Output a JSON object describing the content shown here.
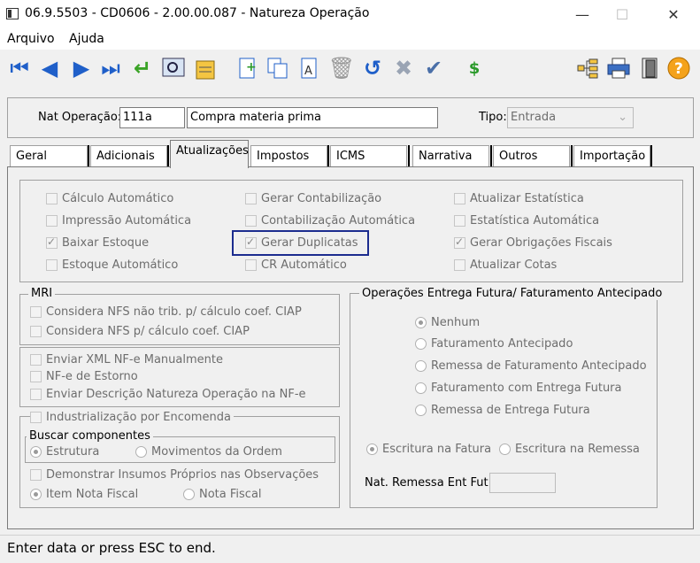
{
  "window": {
    "title": "06.9.5503 - CD0606 - 2.00.00.087 - Natureza Operação",
    "minimize": "—",
    "maximize": "☐",
    "close": "✕"
  },
  "menu": {
    "arquivo": "Arquivo",
    "ajuda": "Ajuda"
  },
  "toolbar": {
    "icons": [
      "first-record-icon",
      "previous-record-icon",
      "next-record-icon",
      "last-record-icon",
      "go-to-icon",
      "zoom-icon",
      "query-icon",
      "new-record-icon",
      "copy-icon",
      "edit-icon",
      "delete-icon",
      "undo-icon",
      "cancel-icon",
      "save-icon",
      "currency-icon",
      "tree-icon",
      "print-icon",
      "exit-icon",
      "help-icon"
    ]
  },
  "header": {
    "nat_label": "Nat Operação:",
    "nat_code": "111a",
    "nat_desc": "Compra materia prima",
    "tipo_label": "Tipo:",
    "tipo_value": "Entrada"
  },
  "tabs": [
    "Geral",
    "Adicionais",
    "Atualizações",
    "Impostos",
    "ICMS",
    "Narrativa",
    "Outros",
    "Importação"
  ],
  "atualizacoes": {
    "col1": [
      {
        "label": "Cálculo Automático",
        "checked": false
      },
      {
        "label": "Impressão Automática",
        "checked": false
      },
      {
        "label": "Baixar Estoque",
        "checked": true
      },
      {
        "label": "Estoque Automático",
        "checked": false
      }
    ],
    "col2": [
      {
        "label": "Gerar Contabilização",
        "checked": false
      },
      {
        "label": "Contabilização Automática",
        "checked": false
      },
      {
        "label": "Gerar Duplicatas",
        "checked": true
      },
      {
        "label": "CR Automático",
        "checked": false
      }
    ],
    "col3": [
      {
        "label": "Atualizar Estatística",
        "checked": false
      },
      {
        "label": "Estatística Automática",
        "checked": false
      },
      {
        "label": "Gerar Obrigações Fiscais",
        "checked": true
      },
      {
        "label": "Atualizar Cotas",
        "checked": false
      }
    ]
  },
  "mri": {
    "title": "MRI",
    "items": [
      "Considera NFS não trib. p/ cálculo coef. CIAP",
      "Considera NFS p/ cálculo coef. CIAP"
    ]
  },
  "nfe": {
    "items": [
      "Enviar XML NF-e Manualmente",
      "NF-e de Estorno",
      "Enviar Descrição Natureza Operação na NF-e"
    ]
  },
  "industrializacao": {
    "label": "Industrialização por Encomenda",
    "buscar_label": "Buscar componentes",
    "buscar_opts": [
      "Estrutura",
      "Movimentos da Ordem"
    ],
    "demonstrar": "Demonstrar Insumos Próprios nas Observações",
    "item_opts": [
      "Item Nota Fiscal",
      "Nota Fiscal"
    ]
  },
  "futura": {
    "title": "Operações Entrega Futura/ Faturamento Antecipado",
    "options": [
      "Nenhum",
      "Faturamento Antecipado",
      "Remessa de Faturamento Antecipado",
      "Faturamento com Entrega Futura",
      "Remessa de Entrega Futura"
    ],
    "escritura": [
      "Escritura na Fatura",
      "Escritura na Remessa"
    ],
    "nat_remessa_label": "Nat. Remessa Ent Fut:",
    "nat_remessa_value": ""
  },
  "status": "Enter data or press ESC to end."
}
